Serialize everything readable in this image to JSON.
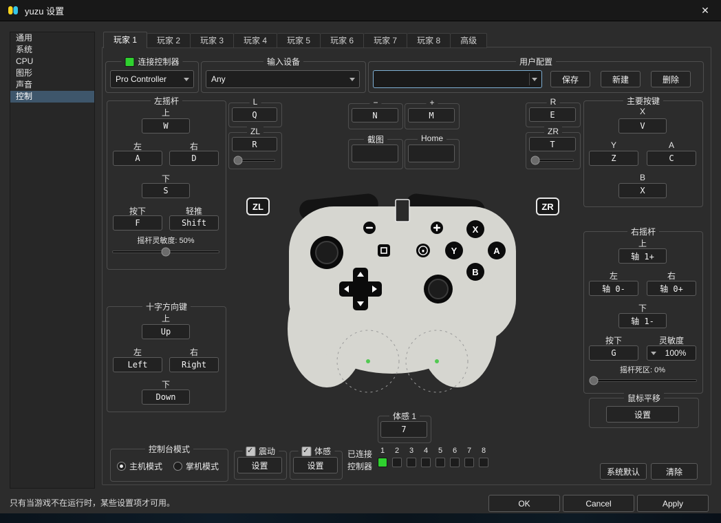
{
  "titlebar": {
    "title": "yuzu 设置",
    "close": "✕"
  },
  "sidebar": [
    "通用",
    "系统",
    "CPU",
    "图形",
    "声音",
    "控制"
  ],
  "tabs": [
    "玩家 1",
    "玩家 2",
    "玩家 3",
    "玩家 4",
    "玩家 5",
    "玩家 6",
    "玩家 7",
    "玩家 8",
    "高级"
  ],
  "connect": {
    "title": "连接控制器",
    "combo": "Pro Controller"
  },
  "input_device": {
    "title": "输入设备",
    "combo": "Any"
  },
  "profile": {
    "title": "用户配置",
    "combo": "",
    "save": "保存",
    "create": "新建",
    "remove": "删除"
  },
  "left_stick": {
    "title": "左摇杆",
    "up_label": "上",
    "up": "W",
    "left_label": "左",
    "left": "A",
    "right_label": "右",
    "right": "D",
    "down_label": "下",
    "down": "S",
    "press_label": "按下",
    "press": "F",
    "modifier_label": "轻推",
    "modifier": "Shift",
    "range": "摇杆灵敏度: 50%"
  },
  "l": {
    "title": "L",
    "btn": "Q"
  },
  "zl": {
    "title": "ZL",
    "btn": "R"
  },
  "minus": {
    "title": "−",
    "btn": "N"
  },
  "plus": {
    "title": "+",
    "btn": "M"
  },
  "screenshot": {
    "title": "截图",
    "btn": ""
  },
  "home": {
    "title": "Home",
    "btn": ""
  },
  "r": {
    "title": "R",
    "btn": "E"
  },
  "zr": {
    "title": "ZR",
    "btn": "T"
  },
  "face": {
    "title": "主要按键",
    "x_label": "X",
    "x": "V",
    "y_label": "Y",
    "y": "Z",
    "a_label": "A",
    "a": "C",
    "b_label": "B",
    "b": "X"
  },
  "dpad": {
    "title": "十字方向键",
    "up_label": "上",
    "up": "Up",
    "left_label": "左",
    "left": "Left",
    "right_label": "右",
    "right": "Right",
    "down_label": "下",
    "down": "Down"
  },
  "right_stick": {
    "title": "右摇杆",
    "up_label": "上",
    "up": "轴 1+",
    "left_label": "左",
    "left": "轴 0-",
    "right_label": "右",
    "right": "轴 0+",
    "down_label": "下",
    "down": "轴 1-",
    "press_label": "按下",
    "press": "G",
    "range_label": "灵敏度",
    "range_value": "100%",
    "deadzone": "摇杆死区: 0%"
  },
  "mouse_panning": {
    "title": "鼠标平移",
    "configure": "设置"
  },
  "motion1": {
    "title": "体感 1",
    "btn": "7"
  },
  "console_mode": {
    "title": "控制台模式",
    "docked": "主机模式",
    "handheld": "掌机模式"
  },
  "vibration": {
    "title": "震动",
    "configure": "设置"
  },
  "motion": {
    "title": "体感",
    "configure": "设置"
  },
  "connected": {
    "line1": "已连接",
    "line2": "控制器",
    "numbers": [
      "1",
      "2",
      "3",
      "4",
      "5",
      "6",
      "7",
      "8"
    ]
  },
  "actions": {
    "defaults": "系统默认",
    "clear": "清除"
  },
  "controller": {
    "zl": "ZL",
    "zr": "ZR",
    "x": "X",
    "y": "Y",
    "a": "A",
    "b": "B"
  },
  "footer": {
    "status": "只有当游戏不在运行时，某些设置项才可用。",
    "ok": "OK",
    "cancel": "Cancel",
    "apply": "Apply"
  },
  "colors": {
    "accent_green": "#2fd12f",
    "selection_blue": "#3e566b",
    "controller_body": "#d6d6d0"
  }
}
